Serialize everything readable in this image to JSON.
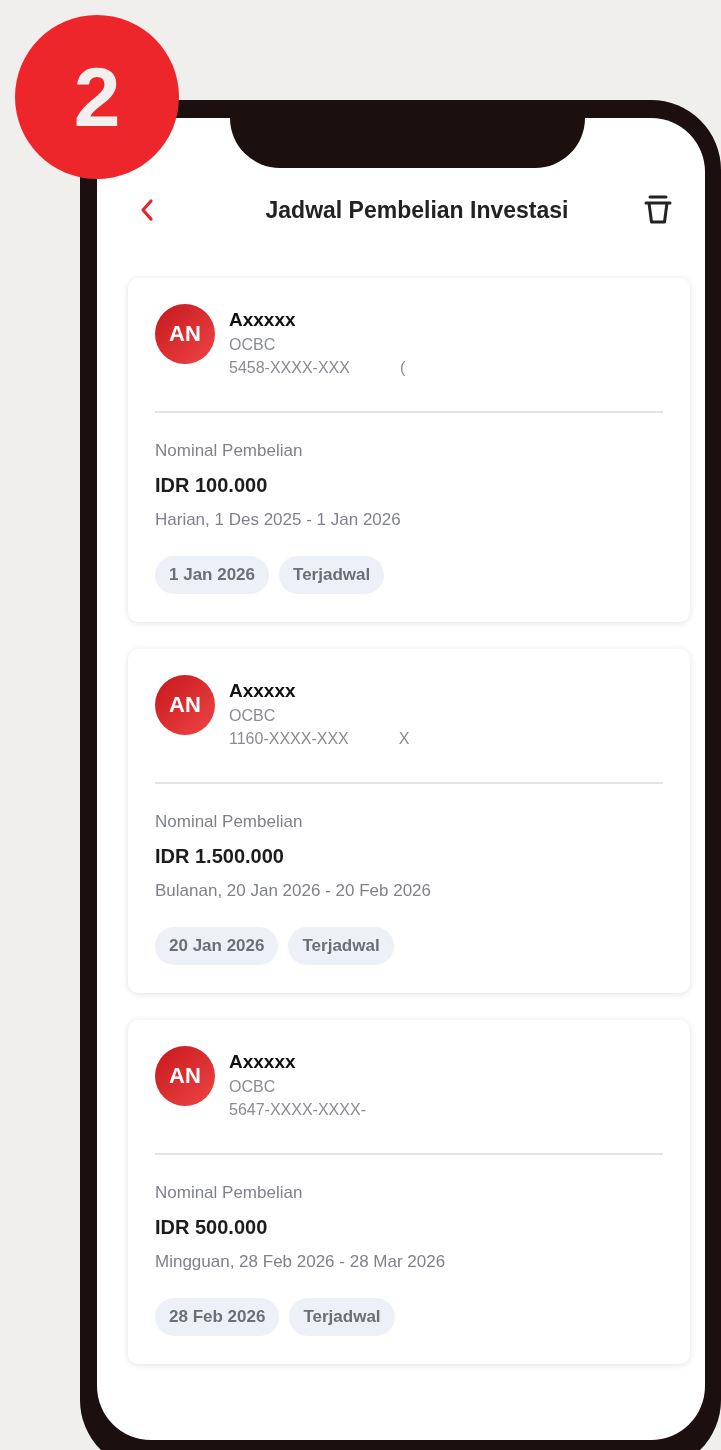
{
  "step_badge": {
    "number": "2"
  },
  "header": {
    "title": "Jadwal Pembelian Investasi"
  },
  "schedules": [
    {
      "initials": "AN",
      "name": "Axxxxx",
      "bank": "OCBC",
      "account": "5458-XXXX-XXX",
      "account_tail": "(",
      "amount_label": "Nominal Pembelian",
      "amount": "IDR 100.000",
      "period": "Harian, 1 Des 2025 - 1 Jan 2026",
      "tags": [
        "1 Jan 2026",
        "Terjadwal"
      ]
    },
    {
      "initials": "AN",
      "name": "Axxxxx",
      "bank": "OCBC",
      "account": "1160-XXXX-XXX",
      "account_tail": "X",
      "amount_label": "Nominal Pembelian",
      "amount": "IDR 1.500.000",
      "period": "Bulanan, 20 Jan 2026 - 20 Feb 2026",
      "tags": [
        "20 Jan 2026",
        "Terjadwal"
      ]
    },
    {
      "initials": "AN",
      "name": "Axxxxx",
      "bank": "OCBC",
      "account": "5647-XXXX-XXXX-",
      "amount_label": "Nominal Pembelian",
      "amount": "IDR 500.000",
      "period": "Mingguan, 28 Feb 2026 - 28 Mar 2026",
      "tags": [
        "28 Feb 2026",
        "Terjadwal"
      ]
    }
  ]
}
